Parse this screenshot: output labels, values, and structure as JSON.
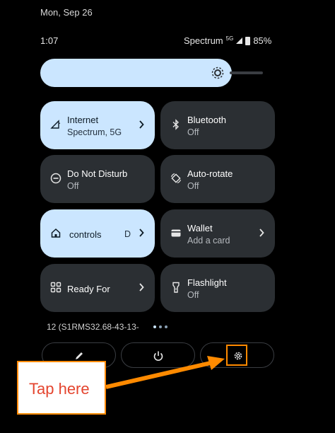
{
  "status": {
    "date": "Mon, Sep 26",
    "time": "1:07",
    "carrier": "Spectrum",
    "network": "5G",
    "battery": "85%"
  },
  "brightness": {
    "level": 0.75
  },
  "tiles": [
    {
      "title": "Internet",
      "subtitle": "Spectrum, 5G",
      "icon": "signal-icon",
      "active": true
    },
    {
      "title": "Bluetooth",
      "subtitle": "Off",
      "icon": "bluetooth-icon",
      "active": false
    },
    {
      "title": "Do Not Disturb",
      "subtitle": "Off",
      "icon": "do-not-disturb-icon",
      "active": false
    },
    {
      "title": "Auto-rotate",
      "subtitle": "Off",
      "icon": "auto-rotate-icon",
      "active": false
    },
    {
      "title": "controls",
      "subtitle": "D",
      "icon": "home-icon",
      "active": true
    },
    {
      "title": "Wallet",
      "subtitle": "Add a card",
      "icon": "wallet-icon",
      "active": false
    },
    {
      "title": "Ready For",
      "subtitle": "",
      "icon": "grid-icon",
      "active": false
    },
    {
      "title": "Flashlight",
      "subtitle": "Off",
      "icon": "flashlight-icon",
      "active": false
    }
  ],
  "build_number": "12 (S1RMS32.68-43-13-",
  "page_indicator": {
    "count": 3,
    "current": 1
  },
  "bottom_actions": [
    "edit-icon",
    "power-icon",
    "settings-gear-icon"
  ],
  "annotation": {
    "callout_text": "Tap here",
    "color": "#ff8a00",
    "text_color": "#e4452f"
  }
}
